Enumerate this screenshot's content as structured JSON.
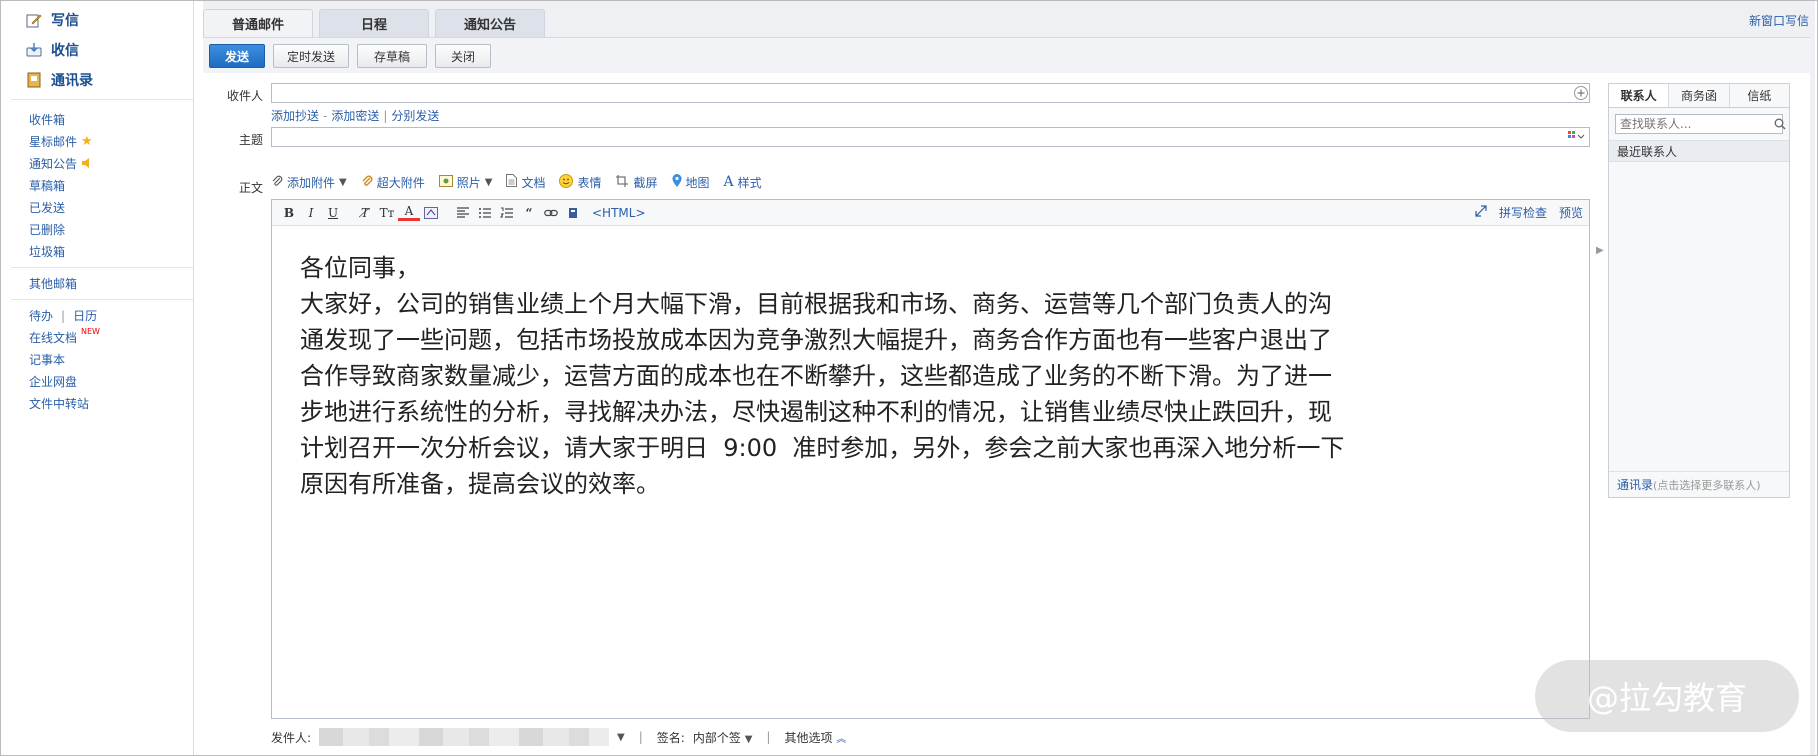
{
  "sidebar": {
    "write": "写信",
    "inbox": "收信",
    "contacts": "通讯录",
    "folders": [
      "收件箱",
      "星标邮件",
      "通知公告",
      "草稿箱",
      "已发送",
      "已删除",
      "垃圾箱"
    ],
    "other_mailbox": "其他邮箱",
    "todo": "待办",
    "calendar": "日历",
    "online_docs": "在线文档",
    "new_badge": "NEW",
    "notes": "记事本",
    "netdisk": "企业网盘",
    "file_transfer": "文件中转站"
  },
  "tabs": [
    "普通邮件",
    "日程",
    "通知公告"
  ],
  "new_window": "新窗口写信",
  "toolbar": {
    "send": "发送",
    "scheduled": "定时发送",
    "save_draft": "存草稿",
    "close": "关闭"
  },
  "compose": {
    "to_label": "收件人",
    "add_cc": "添加抄送",
    "dash": "-",
    "add_bcc": "添加密送",
    "pipe": "|",
    "separate_send": "分别发送",
    "subject_label": "主题",
    "body_label": "正文",
    "attach": {
      "add_attachment": "添加附件",
      "large_attachment": "超大附件",
      "photo": "照片",
      "document": "文档",
      "emoji": "表情",
      "screenshot": "截屏",
      "map": "地图",
      "style": "样式"
    },
    "editor": {
      "html": "<HTML>",
      "spellcheck": "拼写检查",
      "preview": "预览"
    },
    "body_lines": [
      "各位同事，",
      "大家好，公司的销售业绩上个月大幅下滑，目前根据我和市场、商务、运营等几个部门负责人的沟",
      "通发现了一些问题，包括市场投放成本因为竞争激烈大幅提升，商务合作方面也有一些客户退出了",
      "合作导致商家数量减少，运营方面的成本也在不断攀升，这些都造成了业务的不断下滑。为了进一",
      "步地进行系统性的分析，寻找解决办法，尽快遏制这种不利的情况，让销售业绩尽快止跌回升，现",
      "计划召开一次分析会议，请大家于明日  9:00  准时参加，另外，参会之前大家也再深入地分析一下",
      "原因有所准备，提高会议的效率。"
    ],
    "footer": {
      "sender_label": "发件人:",
      "signature_label": "签名:",
      "signature_value": "内部个签",
      "other_options": "其他选项"
    }
  },
  "contacts_panel": {
    "tabs": [
      "联系人",
      "商务函",
      "信纸"
    ],
    "search_placeholder": "查找联系人...",
    "recent": "最近联系人",
    "address_book": "通讯录",
    "address_hint": "(点击选择更多联系人)"
  },
  "watermark": "@拉勾教育"
}
